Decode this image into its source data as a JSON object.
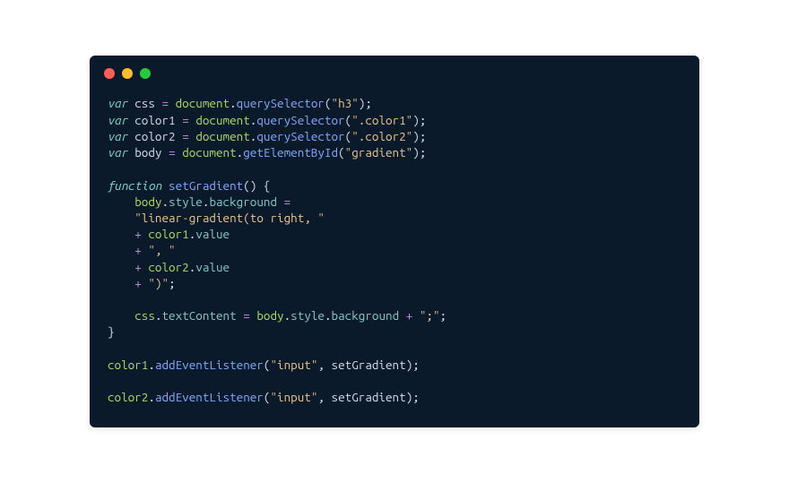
{
  "code": {
    "l1": {
      "kw": "var",
      "v": "css",
      "eq": "=",
      "obj": "document",
      "dot": ".",
      "fn": "querySelector",
      "op": "(",
      "str": "\"h3\"",
      "cp": ")",
      "sc": ";"
    },
    "l2": {
      "kw": "var",
      "v": "color1",
      "eq": "=",
      "obj": "document",
      "dot": ".",
      "fn": "querySelector",
      "op": "(",
      "str": "\".color1\"",
      "cp": ")",
      "sc": ";"
    },
    "l3": {
      "kw": "var",
      "v": "color2",
      "eq": "=",
      "obj": "document",
      "dot": ".",
      "fn": "querySelector",
      "op": "(",
      "str": "\".color2\"",
      "cp": ")",
      "sc": ";"
    },
    "l4": {
      "kw": "var",
      "v": "body",
      "eq": "=",
      "obj": "document",
      "dot": ".",
      "fn": "getElementById",
      "op": "(",
      "str": "\"gradient\"",
      "cp": ")",
      "sc": ";"
    },
    "l5": {
      "kw": "function",
      "fn": "setGradient",
      "op": "(",
      "cp": ")",
      "ob": "{"
    },
    "l6": {
      "ind": "    ",
      "obj": "body",
      "d1": ".",
      "p1": "style",
      "d2": ".",
      "p2": "background",
      "eq": "="
    },
    "l7": {
      "ind": "    ",
      "str": "\"linear-gradient(to right, \""
    },
    "l8": {
      "ind": "    ",
      "plus": "+",
      "obj": "color1",
      "dot": ".",
      "prop": "value"
    },
    "l9": {
      "ind": "    ",
      "plus": "+",
      "str": "\", \""
    },
    "l10": {
      "ind": "    ",
      "plus": "+",
      "obj": "color2",
      "dot": ".",
      "prop": "value"
    },
    "l11": {
      "ind": "    ",
      "plus": "+",
      "str": "\")\"",
      "sc": ";"
    },
    "l12": {
      "ind": "    ",
      "obj": "css",
      "d1": ".",
      "p1": "textContent",
      "eq": "=",
      "obj2": "body",
      "d2": ".",
      "p2": "style",
      "d3": ".",
      "p3": "background",
      "plus": "+",
      "str": "\";\"",
      "sc": ";"
    },
    "l13": {
      "cb": "}"
    },
    "l14": {
      "obj": "color1",
      "dot": ".",
      "fn": "addEventListener",
      "op": "(",
      "str": "\"input\"",
      "cm": ",",
      "arg": "setGradient",
      "cp": ")",
      "sc": ";"
    },
    "l15": {
      "obj": "color2",
      "dot": ".",
      "fn": "addEventListener",
      "op": "(",
      "str": "\"input\"",
      "cm": ",",
      "arg": "setGradient",
      "cp": ")",
      "sc": ";"
    }
  }
}
